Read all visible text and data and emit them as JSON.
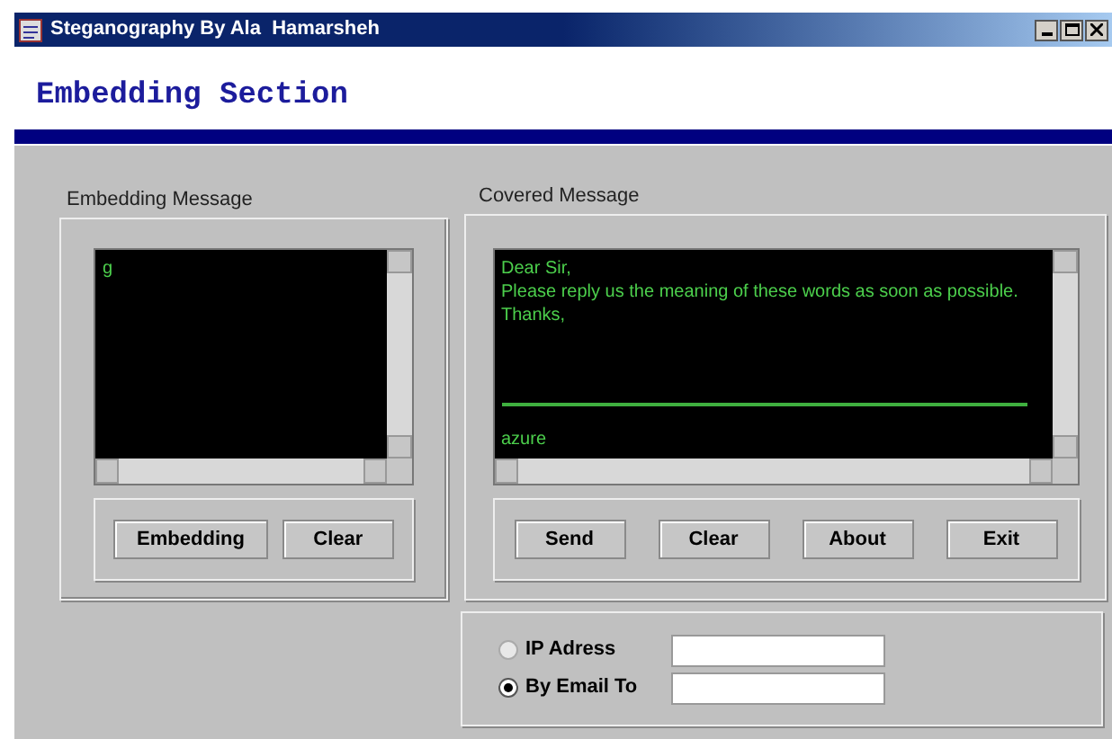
{
  "window": {
    "title": "Steganography By Ala  Hamarsheh"
  },
  "heading": "Embedding Section",
  "embedding": {
    "label": "Embedding Message",
    "text": "g",
    "buttons": [
      "Embedding",
      "Clear"
    ]
  },
  "covered": {
    "label": "Covered Message",
    "lines": [
      "Dear Sir,",
      "Please reply us the meaning of these words as soon as possible.",
      "Thanks,"
    ],
    "signature": "azure",
    "buttons": [
      "Send",
      "Clear",
      "About",
      "Exit"
    ]
  },
  "send_options": [
    {
      "label": "IP Adress",
      "selected": false
    },
    {
      "label": "By Email To",
      "selected": true
    }
  ]
}
